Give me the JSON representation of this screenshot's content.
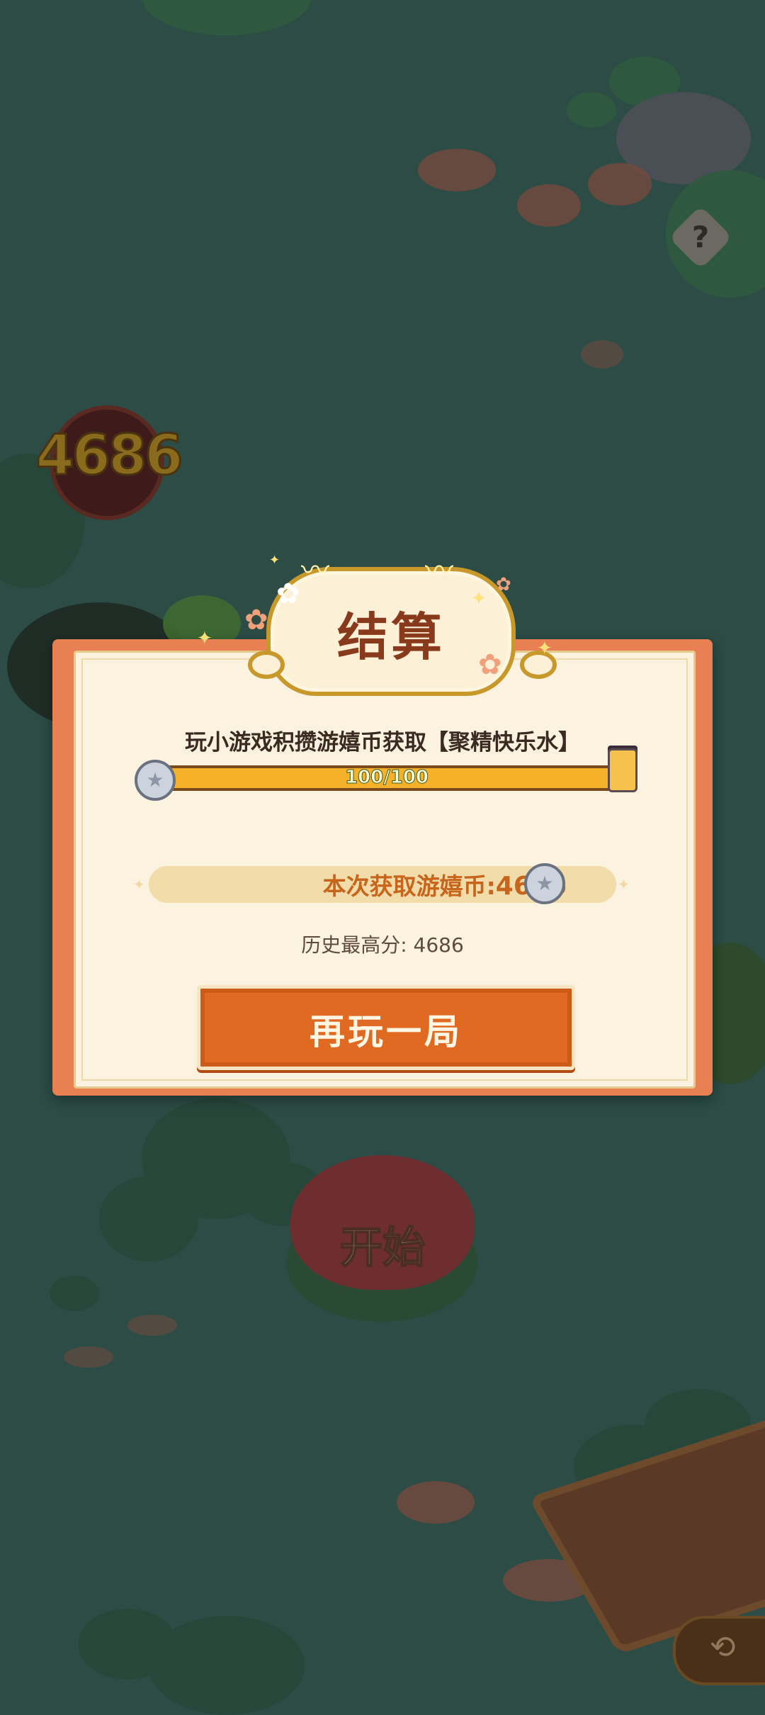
{
  "game": {
    "score_badge": "4686",
    "help_icon": "?",
    "start_label": "开始"
  },
  "settlement": {
    "title": "结算",
    "task_text": "玩小游戏积攒游嬉币获取【聚精快乐水】",
    "progress": {
      "current": 100,
      "max": 100,
      "fraction": 1.0,
      "label": "100/100"
    },
    "earned_label": "本次获取游嬉币:",
    "earned_value": "4686",
    "best_score_text": "历史最高分: 4686",
    "replay_label": "再玩一局"
  },
  "icons": {
    "coin": "silver-coin-icon",
    "jar": "happy-water-jar-icon",
    "help": "question-icon",
    "back": "back-arrow-icon"
  },
  "colors": {
    "modal_frame": "#e98053",
    "modal_bg": "#fbf2df",
    "button": "#e06a22",
    "progress_fill": "#f5b12a",
    "title_text": "#8a3a1c",
    "earned_text": "#c8651c"
  }
}
